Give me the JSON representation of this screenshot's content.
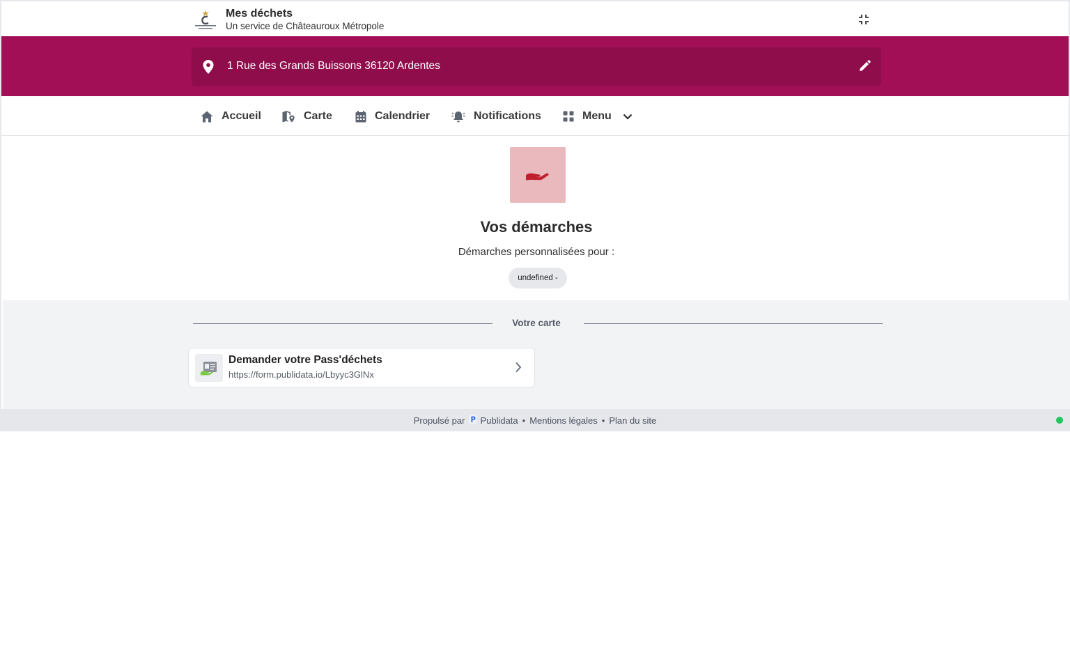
{
  "header": {
    "title": "Mes déchets",
    "subtitle": "Un service de Châteauroux Métropole"
  },
  "address": {
    "text": "1 Rue des Grands Buissons 36120 Ardentes"
  },
  "nav": {
    "items": [
      {
        "label": "Accueil",
        "icon": "home-icon"
      },
      {
        "label": "Carte",
        "icon": "map-pin-icon"
      },
      {
        "label": "Calendrier",
        "icon": "calendar-icon"
      },
      {
        "label": "Notifications",
        "icon": "bell-icon"
      },
      {
        "label": "Menu",
        "icon": "grid-icon"
      }
    ]
  },
  "main": {
    "title": "Vos démarches",
    "subtitle": "Démarches personnalisées pour :",
    "chip": "undefined -"
  },
  "section": {
    "label": "Votre carte"
  },
  "card": {
    "title": "Demander votre Pass'déchets",
    "url": "https://form.publidata.io/Lbyyc3GlNx"
  },
  "footer": {
    "powered_by": "Propulsé par",
    "brand": "Publidata",
    "legal": "Mentions légales",
    "sitemap": "Plan du site"
  },
  "colors": {
    "brand": "#a30f57",
    "brand_dark": "#900d4c",
    "hero_bg": "#eab9bd",
    "hero_icon": "#c0202e",
    "status": "#22c55e"
  }
}
